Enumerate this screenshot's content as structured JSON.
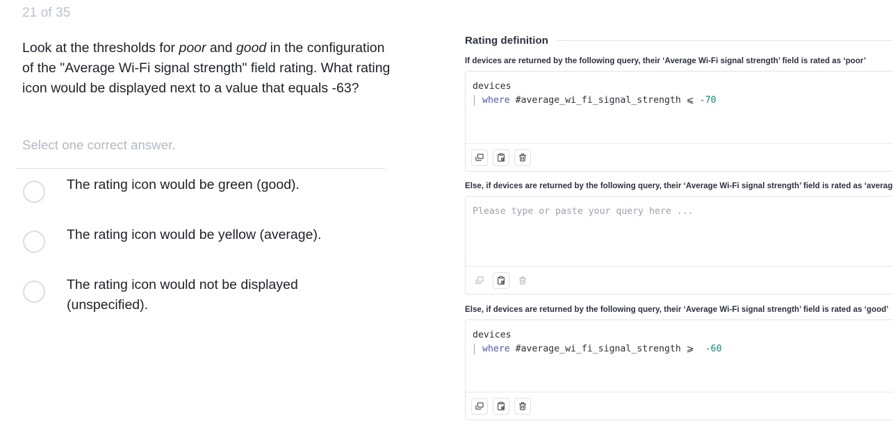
{
  "quiz": {
    "progress": "21 of 35",
    "question_parts": [
      {
        "text": "Look at the thresholds for ",
        "style": "normal"
      },
      {
        "text": "poor",
        "style": "italic"
      },
      {
        "text": " and ",
        "style": "normal"
      },
      {
        "text": "good",
        "style": "italic"
      },
      {
        "text": " in the configuration of the \"Average Wi-Fi signal strength\" field rating. What rating icon would be displayed next to a value that equals -63?",
        "style": "normal"
      }
    ],
    "select_hint": "Select one correct answer.",
    "options": [
      {
        "label": "The rating icon would be green (good).",
        "selected": false
      },
      {
        "label": "The rating icon would be yellow (average).",
        "selected": false
      },
      {
        "label": "The rating icon would not be displayed (unspecified).",
        "selected": false
      }
    ]
  },
  "rating_panel": {
    "title": "Rating definition",
    "blocks": [
      {
        "label": "If devices are returned by the following query, their ‘Average Wi-Fi signal strength’ field is rated as ‘poor’",
        "has_query": true,
        "line1": "devices",
        "kw": "where",
        "field": "#average_wi_fi_signal_strength",
        "operator": "⩽",
        "value": "-70",
        "placeholder": "",
        "toolbar": [
          {
            "icon": "duplicate-icon",
            "label": "Duplicate query",
            "disabled": false
          },
          {
            "icon": "paste-icon",
            "label": "Paste query",
            "disabled": false
          },
          {
            "icon": "trash-icon",
            "label": "Delete query",
            "disabled": false
          }
        ]
      },
      {
        "label": "Else, if devices are returned by the following query, their ‘Average Wi-Fi signal strength’ field is rated as ‘average’",
        "has_query": false,
        "line1": "",
        "kw": "",
        "field": "",
        "operator": "",
        "value": "",
        "placeholder": "Please type or paste your query here ...",
        "toolbar": [
          {
            "icon": "duplicate-icon",
            "label": "Duplicate query",
            "disabled": true
          },
          {
            "icon": "paste-icon",
            "label": "Paste query",
            "disabled": false
          },
          {
            "icon": "trash-icon",
            "label": "Delete query",
            "disabled": true
          }
        ]
      },
      {
        "label": "Else, if devices are returned by the following query, their ‘Average Wi-Fi signal strength’ field is rated as ‘good’",
        "has_query": true,
        "line1": "devices",
        "kw": "where",
        "field": "#average_wi_fi_signal_strength",
        "operator": "⩾",
        "value": "-60",
        "placeholder": "",
        "toolbar": [
          {
            "icon": "duplicate-icon",
            "label": "Duplicate query",
            "disabled": false
          },
          {
            "icon": "paste-icon",
            "label": "Paste query",
            "disabled": false
          },
          {
            "icon": "trash-icon",
            "label": "Delete query",
            "disabled": false
          }
        ]
      }
    ]
  },
  "colors": {
    "keyword": "#4d55d6",
    "number": "#1b8a73",
    "text": "#20222b",
    "muted": "#bcc4d0",
    "border": "#e0e3e8"
  }
}
